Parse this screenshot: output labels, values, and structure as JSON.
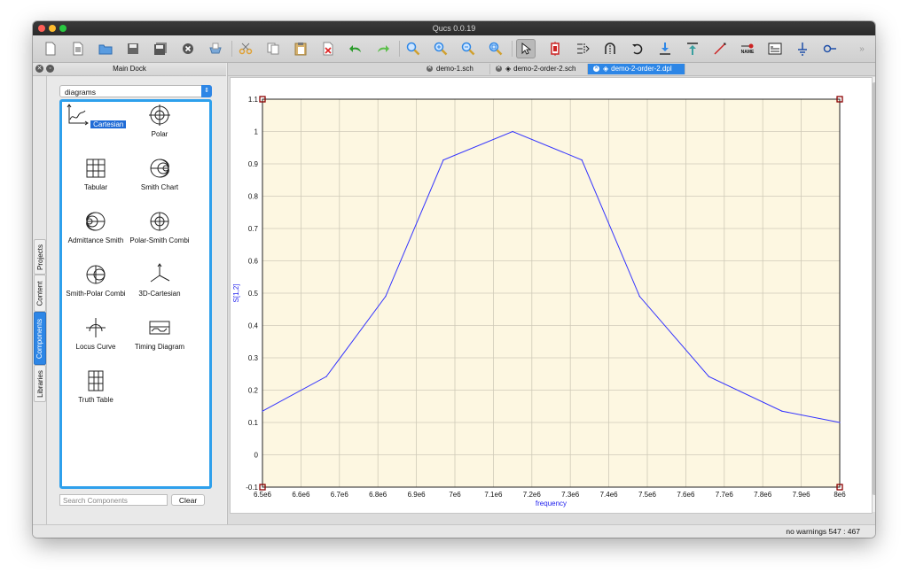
{
  "window": {
    "title": "Qucs 0.0.19"
  },
  "dock": {
    "title": "Main Dock",
    "side_tabs": [
      "Projects",
      "Content",
      "Components",
      "Libraries"
    ],
    "active_side_tab": "Components",
    "category": "diagrams",
    "components": [
      {
        "label": "Cartesian",
        "icon": "cartesian-icon",
        "selected": true
      },
      {
        "label": "Polar",
        "icon": "polar-icon"
      },
      {
        "label": "Tabular",
        "icon": "tabular-icon"
      },
      {
        "label": "Smith Chart",
        "icon": "smith-chart-icon"
      },
      {
        "label": "Admittance Smith",
        "icon": "admittance-smith-icon"
      },
      {
        "label": "Polar-Smith Combi",
        "icon": "polar-smith-icon"
      },
      {
        "label": "Smith-Polar Combi",
        "icon": "smith-polar-icon"
      },
      {
        "label": "3D-Cartesian",
        "icon": "cartesian-3d-icon"
      },
      {
        "label": "Locus Curve",
        "icon": "locus-curve-icon"
      },
      {
        "label": "Timing Diagram",
        "icon": "timing-diagram-icon"
      },
      {
        "label": "Truth Table",
        "icon": "truth-table-icon"
      }
    ],
    "search_placeholder": "Search Components",
    "clear_label": "Clear"
  },
  "tabs": [
    {
      "label": "demo-1.sch",
      "active": false
    },
    {
      "label": "demo-2-order-2.sch",
      "active": false
    },
    {
      "label": "demo-2-order-2.dpl",
      "active": true
    }
  ],
  "toolbar": {
    "icons": [
      "new-file-icon",
      "new-text-icon",
      "open-icon",
      "save-icon",
      "save-all-icon",
      "close-icon",
      "print-icon",
      "cut-icon",
      "copy-icon",
      "paste-icon",
      "delete-icon",
      "undo-icon",
      "redo-icon",
      "zoom-fit-icon",
      "zoom-in-icon",
      "zoom-out-icon",
      "zoom-selection-icon",
      "select-icon",
      "deactivate-icon",
      "mirror-x-icon",
      "mirror-y-icon",
      "rotate-icon",
      "enter-subcircuit-icon",
      "exit-subcircuit-icon",
      "wire-icon",
      "wire-label-icon",
      "equation-icon",
      "ground-icon",
      "port-icon"
    ],
    "label_icon_text": "NAME"
  },
  "status": {
    "text": "no warnings 547 : 467"
  },
  "chart_data": {
    "type": "line",
    "xlabel": "frequency",
    "ylabel": "S[1,2]",
    "xlim": [
      6500000,
      8000000
    ],
    "ylim": [
      -0.1,
      1.1
    ],
    "x_ticks": [
      "6.5e6",
      "6.6e6",
      "6.7e6",
      "6.8e6",
      "6.9e6",
      "7e6",
      "7.1e6",
      "7.2e6",
      "7.3e6",
      "7.4e6",
      "7.5e6",
      "7.6e6",
      "7.7e6",
      "7.8e6",
      "7.9e6",
      "8e6"
    ],
    "y_ticks": [
      "-0.1",
      "0",
      "0.1",
      "0.2",
      "0.3",
      "0.4",
      "0.5",
      "0.6",
      "0.7",
      "0.8",
      "0.9",
      "1",
      "1.1"
    ],
    "grid": true,
    "background": "#fdf7e1",
    "series_color": "#3333ff",
    "series": [
      {
        "x": [
          6500000,
          6666000,
          6820000,
          6970000,
          7150000,
          7330000,
          7480000,
          7660000,
          7850000,
          8000000
        ],
        "y": [
          0.135,
          0.242,
          0.49,
          0.912,
          1.0,
          0.912,
          0.49,
          0.242,
          0.135,
          0.1
        ]
      }
    ]
  }
}
